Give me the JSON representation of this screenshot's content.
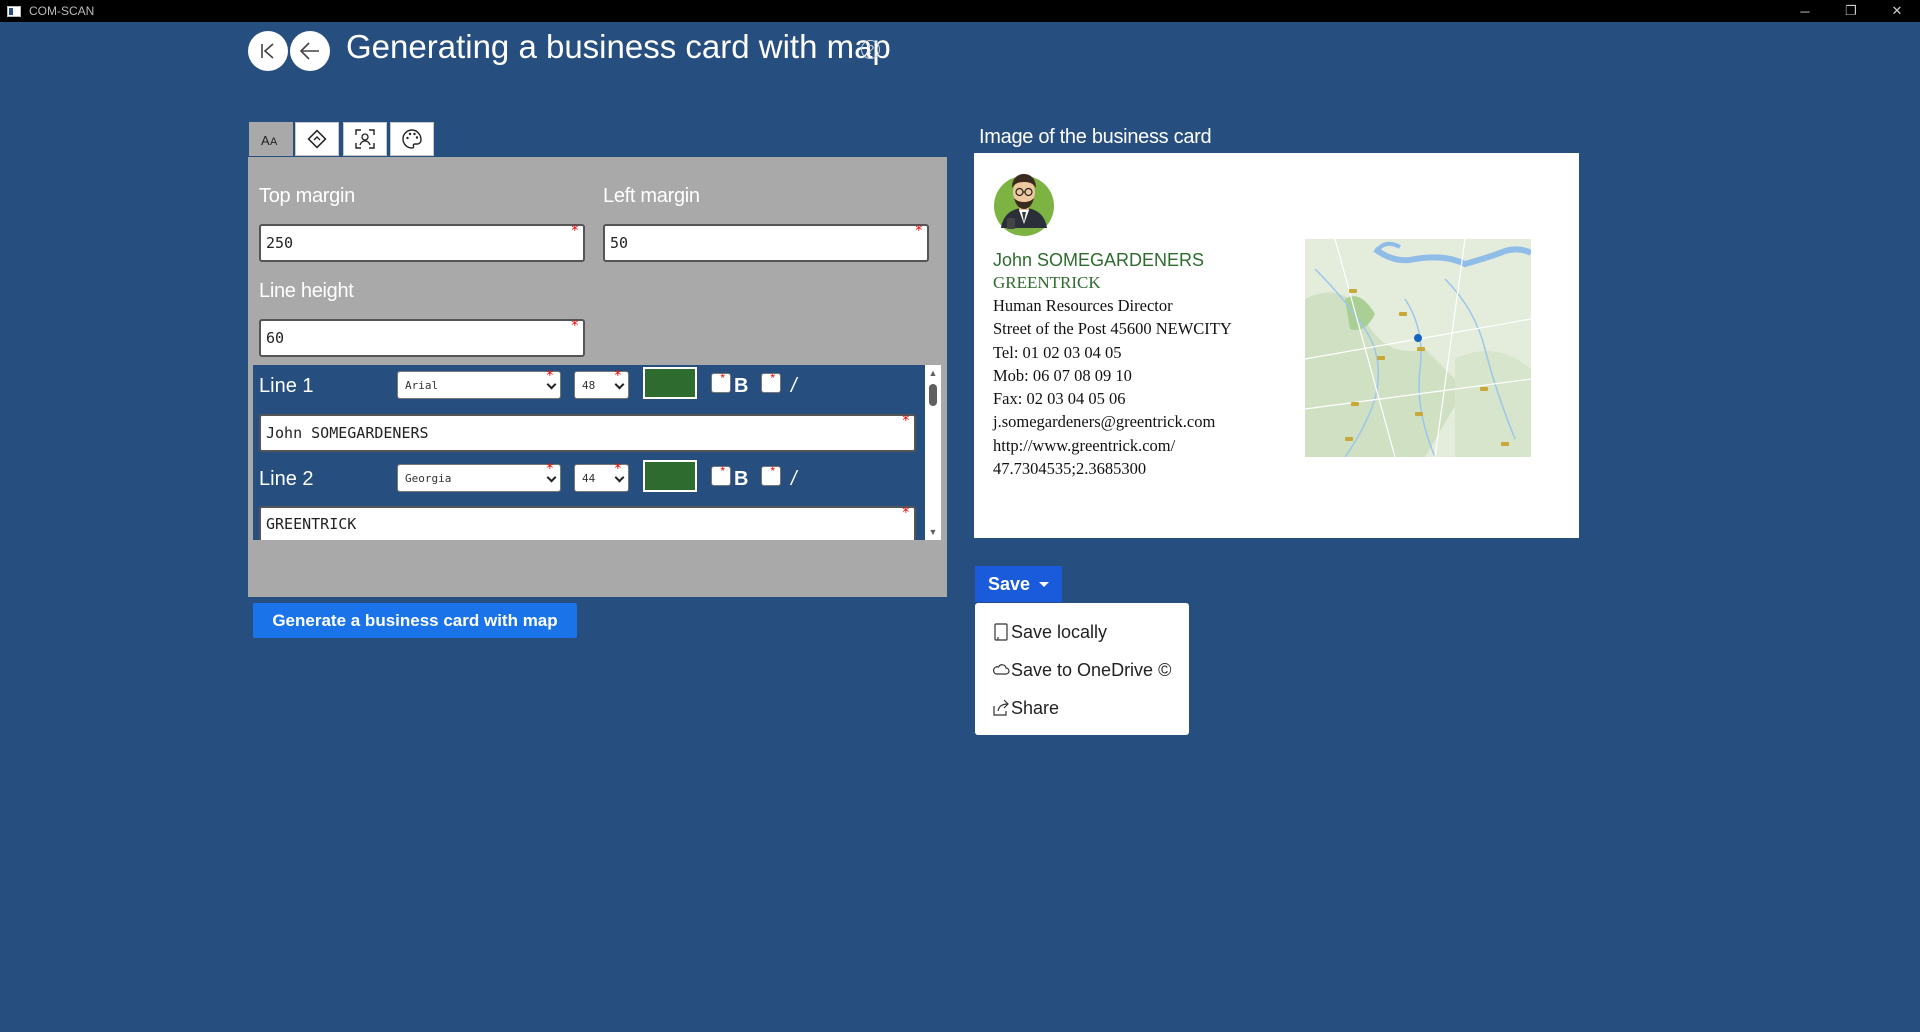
{
  "window": {
    "title": "COM-SCAN",
    "minimize": "─",
    "restore": "❐",
    "close": "✕"
  },
  "header": {
    "title": "Generating a business card with map",
    "help": "?"
  },
  "tabs": [
    {
      "name": "text-format",
      "icon": "text-size-icon"
    },
    {
      "name": "position",
      "icon": "diamond-arrow-icon"
    },
    {
      "name": "contact",
      "icon": "person-frame-icon"
    },
    {
      "name": "palette",
      "icon": "palette-icon"
    }
  ],
  "form": {
    "top_margin": {
      "label": "Top margin",
      "value": "250"
    },
    "left_margin": {
      "label": "Left margin",
      "value": "50"
    },
    "line_height": {
      "label": "Line height",
      "value": "60"
    }
  },
  "lines": [
    {
      "label": "Line 1",
      "font": "Arial",
      "size": "48",
      "color": "#2e6b2e",
      "bold_label": "B",
      "italic_label": "/",
      "text": "John SOMEGARDENERS"
    },
    {
      "label": "Line 2",
      "font": "Georgia",
      "size": "44",
      "color": "#2e6b2e",
      "bold_label": "B",
      "italic_label": "/",
      "text": "GREENTRICK"
    }
  ],
  "generate_button": "Generate a business card with map",
  "card": {
    "heading": "Image of the business card",
    "name": "John SOMEGARDENERS",
    "company": "GREENTRICK",
    "job_title": "Human Resources Director",
    "address": "Street of the Post 45600 NEWCITY",
    "tel": "Tel: 01 02 03 04 05",
    "mob": "Mob: 06 07 08 09 10",
    "fax": "Fax: 02 03 04 05 06",
    "email": "j.somegardeners@greentrick.com",
    "website": "http://www.greentrick.com/",
    "coords": "47.7304535;2.3685300"
  },
  "save": {
    "label": "Save",
    "menu": [
      {
        "label": "Save locally",
        "icon": "device-icon"
      },
      {
        "label": "Save to OneDrive ©",
        "icon": "cloud-icon"
      },
      {
        "label": "Share",
        "icon": "share-icon"
      }
    ]
  },
  "colors": {
    "background": "#264e7e",
    "panel": "#a9a9a9",
    "accent": "#1a73e8",
    "card_green": "#2e6b2e"
  }
}
